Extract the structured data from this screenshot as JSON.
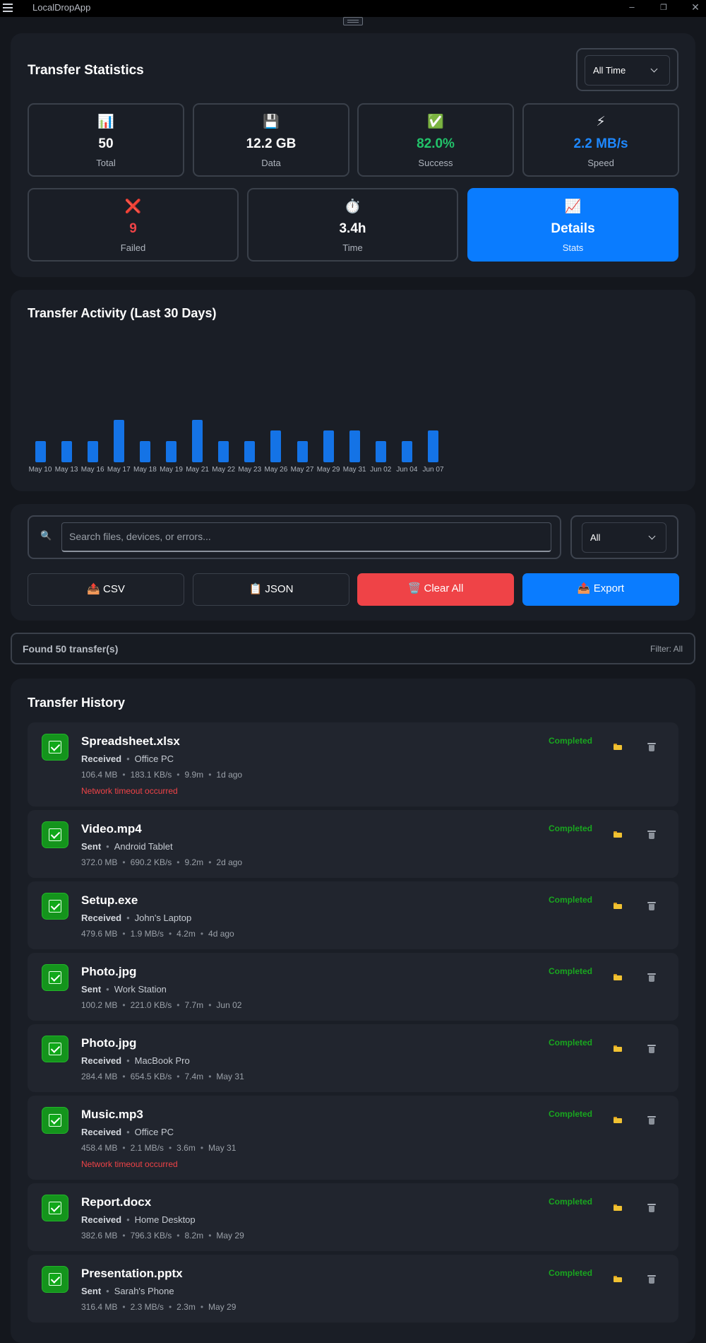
{
  "titlebar": {
    "app_title": "LocalDropApp"
  },
  "statistics": {
    "title": "Transfer Statistics",
    "time_filter": "All Time",
    "cards": [
      {
        "icon": "bar-chart-icon",
        "value": "50",
        "label": "Total"
      },
      {
        "icon": "floppy-disk-icon",
        "value": "12.2 GB",
        "label": "Data"
      },
      {
        "icon": "check-mark-icon",
        "value": "82.0%",
        "label": "Success",
        "color": "#22c36a"
      },
      {
        "icon": "lightning-icon",
        "value": "2.2 MB/s",
        "label": "Speed",
        "color": "#1e88ff"
      },
      {
        "icon": "cross-mark-icon",
        "value": "9",
        "label": "Failed",
        "color": "#ef4347"
      },
      {
        "icon": "stopwatch-icon",
        "value": "3.4h",
        "label": "Time"
      },
      {
        "icon": "trend-chart-icon",
        "value": "Details",
        "label": "Stats"
      }
    ]
  },
  "activity": {
    "title": "Transfer Activity (Last 30 Days)"
  },
  "chart_data": {
    "type": "bar",
    "title": "Transfer Activity (Last 30 Days)",
    "categories": [
      "May 10",
      "May 13",
      "May 16",
      "May 17",
      "May 18",
      "May 19",
      "May 21",
      "May 22",
      "May 23",
      "May 26",
      "May 27",
      "May 29",
      "May 31",
      "Jun 02",
      "Jun 04",
      "Jun 07"
    ],
    "values": [
      1,
      1,
      1,
      2,
      1,
      1,
      2,
      1,
      1,
      1.5,
      1,
      1.5,
      1.5,
      1,
      1,
      1.5
    ],
    "color": "#1473e6",
    "grid": false
  },
  "controls": {
    "search_placeholder": "Search files, devices, or errors...",
    "type_filter": "All",
    "csv_label": "📤 CSV",
    "json_label": "📋 JSON",
    "clear_label": "🗑️ Clear All",
    "export_label": "📤 Export"
  },
  "results": {
    "found_text": "Found 50 transfer(s)",
    "filter_text": "Filter: All"
  },
  "history": {
    "title": "Transfer History",
    "items": [
      {
        "name": "Spreadsheet.xlsx",
        "direction": "Received",
        "device": "Office PC",
        "size": "106.4 MB",
        "speed": "183.1 KB/s",
        "duration": "9.9m",
        "when": "1d ago",
        "error": "Network timeout occurred",
        "status": "Completed"
      },
      {
        "name": "Video.mp4",
        "direction": "Sent",
        "device": "Android Tablet",
        "size": "372.0 MB",
        "speed": "690.2 KB/s",
        "duration": "9.2m",
        "when": "2d ago",
        "error": "",
        "status": "Completed"
      },
      {
        "name": "Setup.exe",
        "direction": "Received",
        "device": "John's Laptop",
        "size": "479.6 MB",
        "speed": "1.9 MB/s",
        "duration": "4.2m",
        "when": "4d ago",
        "error": "",
        "status": "Completed"
      },
      {
        "name": "Photo.jpg",
        "direction": "Sent",
        "device": "Work Station",
        "size": "100.2 MB",
        "speed": "221.0 KB/s",
        "duration": "7.7m",
        "when": "Jun 02",
        "error": "",
        "status": "Completed"
      },
      {
        "name": "Photo.jpg",
        "direction": "Received",
        "device": "MacBook Pro",
        "size": "284.4 MB",
        "speed": "654.5 KB/s",
        "duration": "7.4m",
        "when": "May 31",
        "error": "",
        "status": "Completed"
      },
      {
        "name": "Music.mp3",
        "direction": "Received",
        "device": "Office PC",
        "size": "458.4 MB",
        "speed": "2.1 MB/s",
        "duration": "3.6m",
        "when": "May 31",
        "error": "Network timeout occurred",
        "status": "Completed"
      },
      {
        "name": "Report.docx",
        "direction": "Received",
        "device": "Home Desktop",
        "size": "382.6 MB",
        "speed": "796.3 KB/s",
        "duration": "8.2m",
        "when": "May 29",
        "error": "",
        "status": "Completed"
      },
      {
        "name": "Presentation.pptx",
        "direction": "Sent",
        "device": "Sarah's Phone",
        "size": "316.4 MB",
        "speed": "2.3 MB/s",
        "duration": "2.3m",
        "when": "May 29",
        "error": "",
        "status": "Completed"
      }
    ]
  }
}
